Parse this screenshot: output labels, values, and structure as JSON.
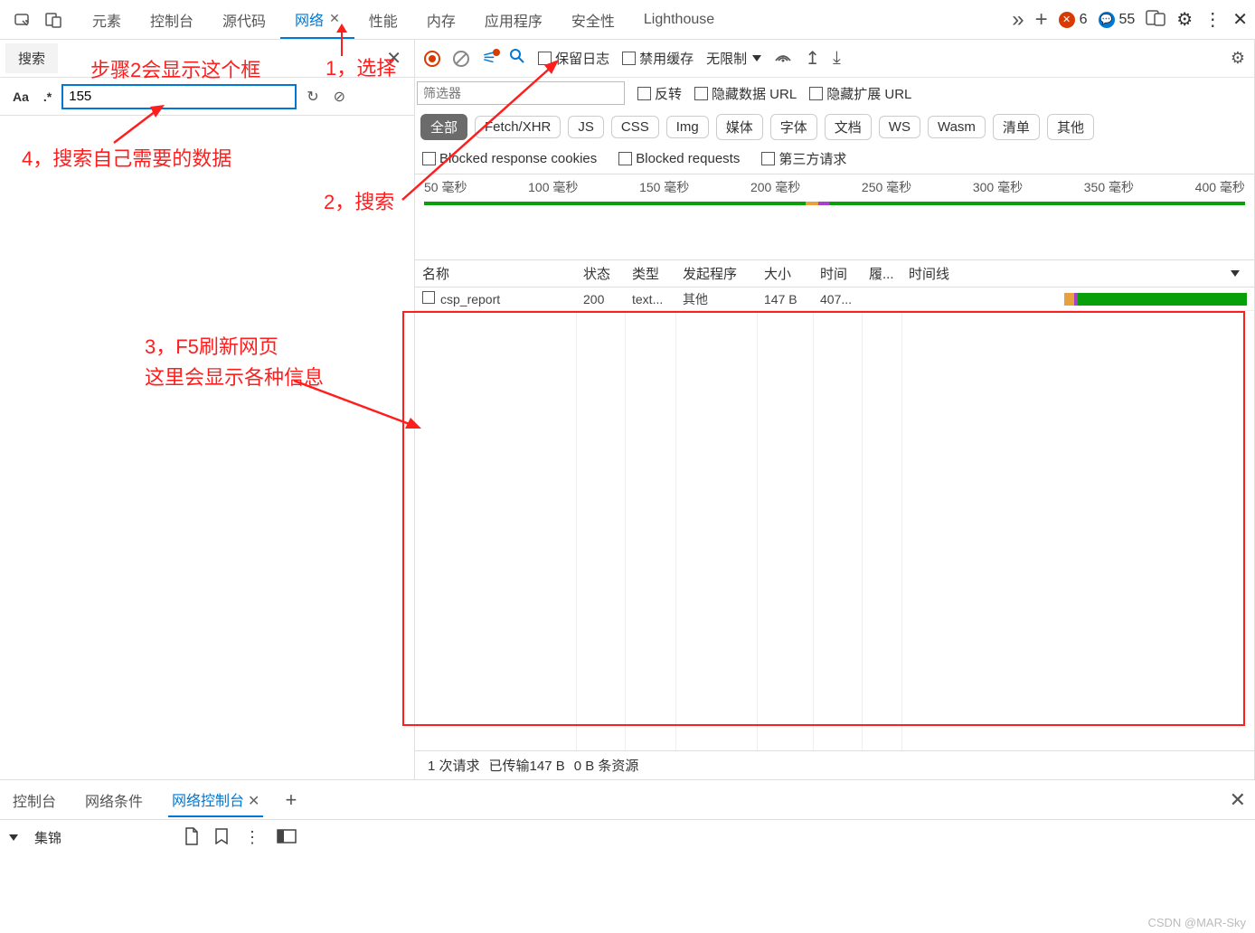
{
  "top": {
    "tabs": [
      "元素",
      "控制台",
      "源代码",
      "网络",
      "性能",
      "内存",
      "应用程序",
      "安全性",
      "Lighthouse"
    ],
    "active_tab": "网络",
    "errors": "6",
    "messages": "55"
  },
  "search_panel": {
    "tab": "搜索",
    "aa": "Aa",
    "regex": ".*",
    "value": "155"
  },
  "net_toolbar": {
    "preserve_log": "保留日志",
    "disable_cache": "禁用缓存",
    "throttle": "无限制"
  },
  "filter": {
    "placeholder": "筛选器",
    "invert": "反转",
    "hide_data": "隐藏数据 URL",
    "hide_ext": "隐藏扩展 URL",
    "types": [
      "全部",
      "Fetch/XHR",
      "JS",
      "CSS",
      "Img",
      "媒体",
      "字体",
      "文档",
      "WS",
      "Wasm",
      "清单",
      "其他"
    ],
    "blocked_cookies": "Blocked response cookies",
    "blocked_req": "Blocked requests",
    "third_party": "第三方请求"
  },
  "overview_ticks": [
    "50 毫秒",
    "100 毫秒",
    "150 毫秒",
    "200 毫秒",
    "250 毫秒",
    "300 毫秒",
    "350 毫秒",
    "400 毫秒"
  ],
  "columns": {
    "name": "名称",
    "status": "状态",
    "type": "类型",
    "initiator": "发起程序",
    "size": "大小",
    "time": "时间",
    "cov": "履...",
    "waterfall": "时间线"
  },
  "rows": [
    {
      "name": "csp_report",
      "status": "200",
      "type": "text...",
      "initiator": "其他",
      "size": "147 B",
      "time": "407..."
    }
  ],
  "footer": {
    "requests": "1 次请求",
    "transfer": "已传输147 B",
    "resources": "0 B 条资源"
  },
  "drawer": {
    "tabs": [
      "控制台",
      "网络条件",
      "网络控制台"
    ]
  },
  "bottom": {
    "label": "集锦"
  },
  "annotations": {
    "a1": "1，选择",
    "a2": "2，搜索",
    "a2b": "步骤2会显示这个框",
    "a3": "3，F5刷新网页",
    "a3b": "这里会显示各种信息",
    "a4": "4，搜索自己需要的数据"
  },
  "watermark": "CSDN @MAR-Sky"
}
